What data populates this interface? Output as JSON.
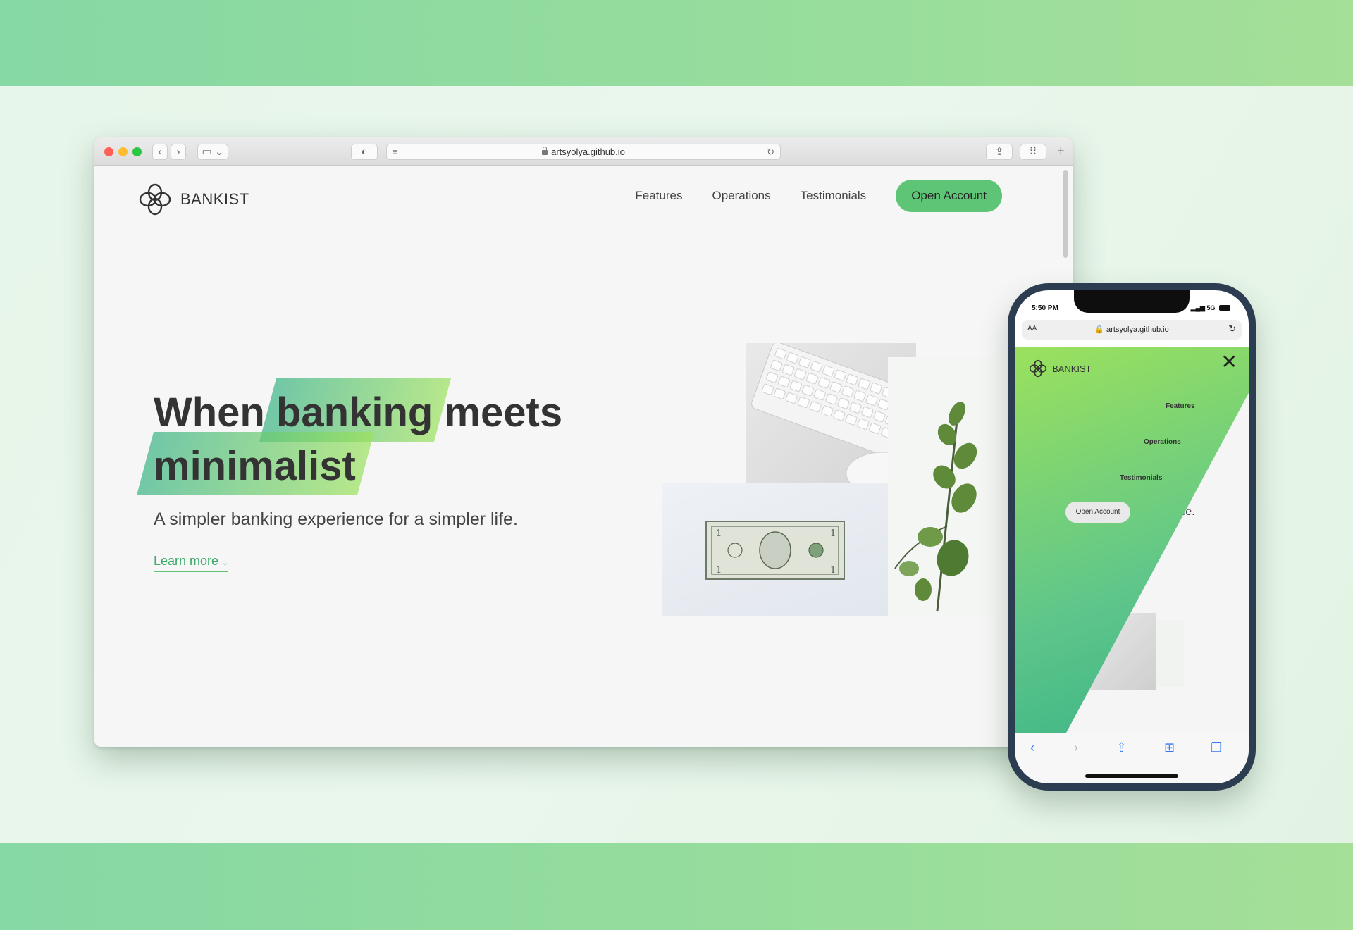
{
  "browser": {
    "url": "artsyolya.github.io"
  },
  "site": {
    "logo_text": "BANKIST",
    "nav": [
      {
        "label": "Features"
      },
      {
        "label": "Operations"
      },
      {
        "label": "Testimonials"
      }
    ],
    "cta_label": "Open Account",
    "hero": {
      "line1_pre": "When ",
      "line1_hl": "banking",
      "line1_post": " meets",
      "line2_hl": "minimalist",
      "subtitle": "A simpler banking experience for a simpler life.",
      "learn_more": "Learn more ↓"
    },
    "colors": {
      "accent": "#5ec576",
      "gradient_start": "#39b385",
      "gradient_end": "#9be15d"
    }
  },
  "phone": {
    "status_time": "5:50 PM",
    "status_network": "5G",
    "url_aa": "AA",
    "url": "artsyolya.github.io",
    "logo_text": "BANKIST",
    "close_label": "✕",
    "menu": [
      {
        "label": "Features"
      },
      {
        "label": "Operations"
      },
      {
        "label": "Testimonials"
      }
    ],
    "cta_label": "Open Account",
    "hero_fragment": "er life.",
    "toolbar_icons": [
      "back-icon",
      "forward-icon",
      "share-icon",
      "bookmarks-icon",
      "tabs-icon"
    ]
  }
}
